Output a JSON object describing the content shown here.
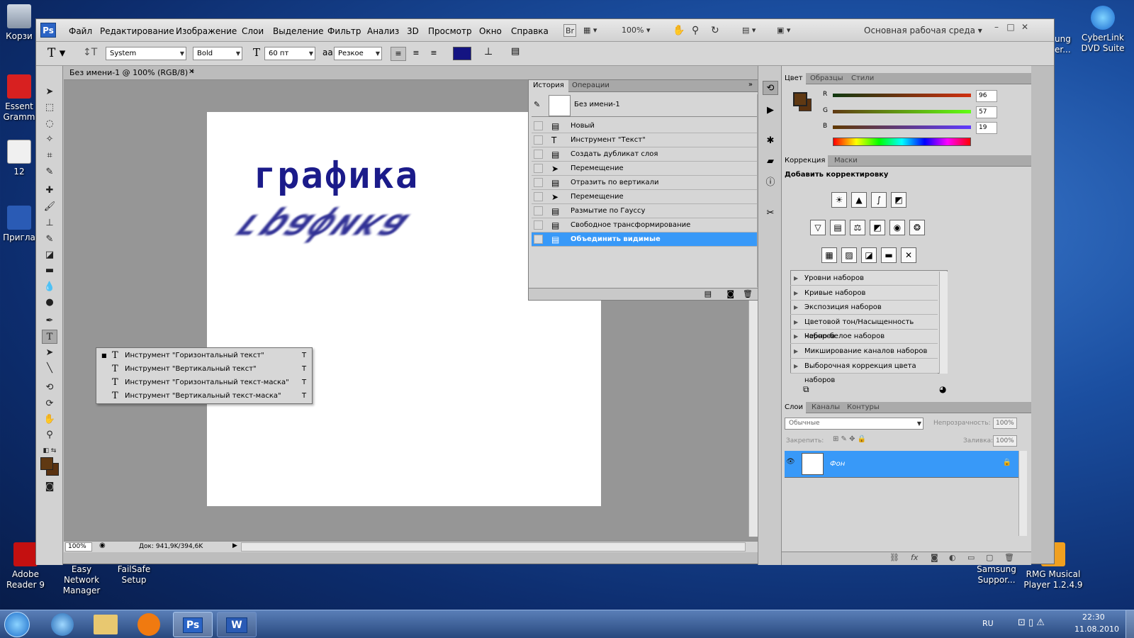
{
  "desktop": {
    "icons": [
      {
        "label": "Корзи"
      },
      {
        "label": "Essent Gramm"
      },
      {
        "label": "12"
      },
      {
        "label": "Пригла"
      },
      {
        "label": "Adobe Reader 9"
      },
      {
        "label": "Easy Network Manager"
      },
      {
        "label": "FailSafe Setup"
      },
      {
        "label": "ung er..."
      },
      {
        "label": "CyberLink DVD Suite"
      },
      {
        "label": "Samsung Suppor..."
      },
      {
        "label": "RMG Musical Player 1.2.4.9"
      }
    ]
  },
  "app": {
    "logo": "Ps",
    "menu": [
      "Файл",
      "Редактирование",
      "Изображение",
      "Слои",
      "Выделение",
      "Фильтр",
      "Анализ",
      "3D",
      "Просмотр",
      "Окно",
      "Справка"
    ],
    "bridge_button": "Br",
    "zoom": "100%",
    "workspace": "Основная рабочая среда",
    "window_controls": [
      "–",
      "□",
      "✕"
    ]
  },
  "options": {
    "font_family": "System",
    "font_style": "Bold",
    "font_size": "60 пт",
    "aa_label": "аа",
    "antialias": "Резкое",
    "text_color": "#141482"
  },
  "document": {
    "tab_title": "Без имени-1 @ 100% (RGB/8) *",
    "close": "✕",
    "text_main": "графика",
    "text_reflected": "графика",
    "text_color": "#1b1b8a",
    "zoom": "100%",
    "doc_info": "Док: 941,9K/394,6K"
  },
  "history": {
    "tabs": [
      "История",
      "Операции"
    ],
    "snapshot": "Без имени-1",
    "items": [
      {
        "label": "Новый",
        "icon": "doc-icon"
      },
      {
        "label": "Инструмент \"Текст\"",
        "icon": "type-icon"
      },
      {
        "label": "Создать дубликат слоя",
        "icon": "doc-icon"
      },
      {
        "label": "Перемещение",
        "icon": "move-icon"
      },
      {
        "label": "Отразить по вертикали",
        "icon": "doc-icon"
      },
      {
        "label": "Перемещение",
        "icon": "move-icon"
      },
      {
        "label": "Размытие по Гауссу",
        "icon": "doc-icon"
      },
      {
        "label": "Свободное трансформирование",
        "icon": "doc-icon"
      },
      {
        "label": "Объединить видимые",
        "icon": "doc-icon",
        "selected": true
      }
    ]
  },
  "type_flyout": [
    {
      "label": "Инструмент \"Горизонтальный текст\"",
      "key": "T",
      "active": true
    },
    {
      "label": "Инструмент \"Вертикальный текст\"",
      "key": "T"
    },
    {
      "label": "Инструмент \"Горизонтальный текст-маска\"",
      "key": "T"
    },
    {
      "label": "Инструмент \"Вертикальный текст-маска\"",
      "key": "T"
    }
  ],
  "color_panel": {
    "tabs": [
      "Цвет",
      "Образцы",
      "Стили"
    ],
    "channels": [
      {
        "name": "R",
        "value": "96"
      },
      {
        "name": "G",
        "value": "57"
      },
      {
        "name": "B",
        "value": "19"
      }
    ],
    "foreground": "#603913",
    "background": "#5a3210"
  },
  "adjust_panel": {
    "tabs": [
      "Коррекция",
      "Маски"
    ],
    "title": "Добавить корректировку",
    "presets": [
      "Уровни наборов",
      "Кривые наборов",
      "Экспозиция наборов",
      "Цветовой тон/Насыщенность наборов",
      "Черно-белое наборов",
      "Микширование каналов наборов",
      "Выборочная коррекция цвета наборов"
    ]
  },
  "layers": {
    "tabs": [
      "Слои",
      "Каналы",
      "Контуры"
    ],
    "blend_mode": "Обычные",
    "opacity_label": "Непрозрачность:",
    "opacity": "100%",
    "lock_label": "Закрепить:",
    "fill_label": "Заливка:",
    "fill": "100%",
    "layer_name": "Фон"
  },
  "taskbar": {
    "apps": [
      "Ps",
      "W"
    ],
    "lang": "RU",
    "time": "22:30",
    "date": "11.08.2010"
  }
}
